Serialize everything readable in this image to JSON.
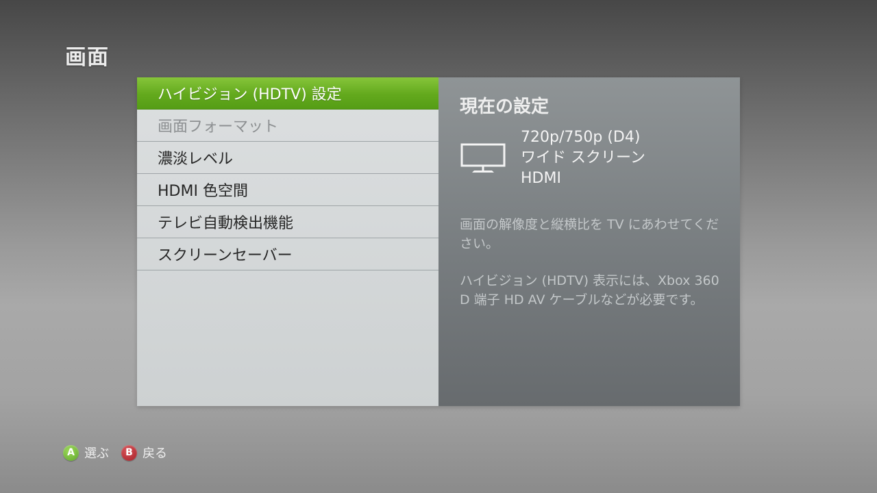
{
  "page": {
    "title": "画面"
  },
  "menu": {
    "items": [
      {
        "label": "ハイビジョン (HDTV) 設定",
        "state": "selected"
      },
      {
        "label": "画面フォーマット",
        "state": "disabled"
      },
      {
        "label": "濃淡レベル",
        "state": "normal"
      },
      {
        "label": "HDMI 色空間",
        "state": "normal"
      },
      {
        "label": "テレビ自動検出機能",
        "state": "normal"
      },
      {
        "label": "スクリーンセーバー",
        "state": "normal"
      }
    ]
  },
  "info": {
    "heading": "現在の設定",
    "icon": "tv-icon",
    "current": {
      "resolution": "720p/750p (D4)",
      "aspect": "ワイド スクリーン",
      "connection": "HDMI"
    },
    "description1": "画面の解像度と縦横比を TV にあわせてください。",
    "description2": "ハイビジョン (HDTV) 表示には、Xbox 360 D 端子 HD AV ケーブルなどが必要です。"
  },
  "footer": {
    "a_button": "A",
    "a_label": "選ぶ",
    "b_button": "B",
    "b_label": "戻る"
  },
  "colors": {
    "selected_accent": "#63a91d",
    "a_button": "#6fb233",
    "b_button": "#b5252d"
  }
}
